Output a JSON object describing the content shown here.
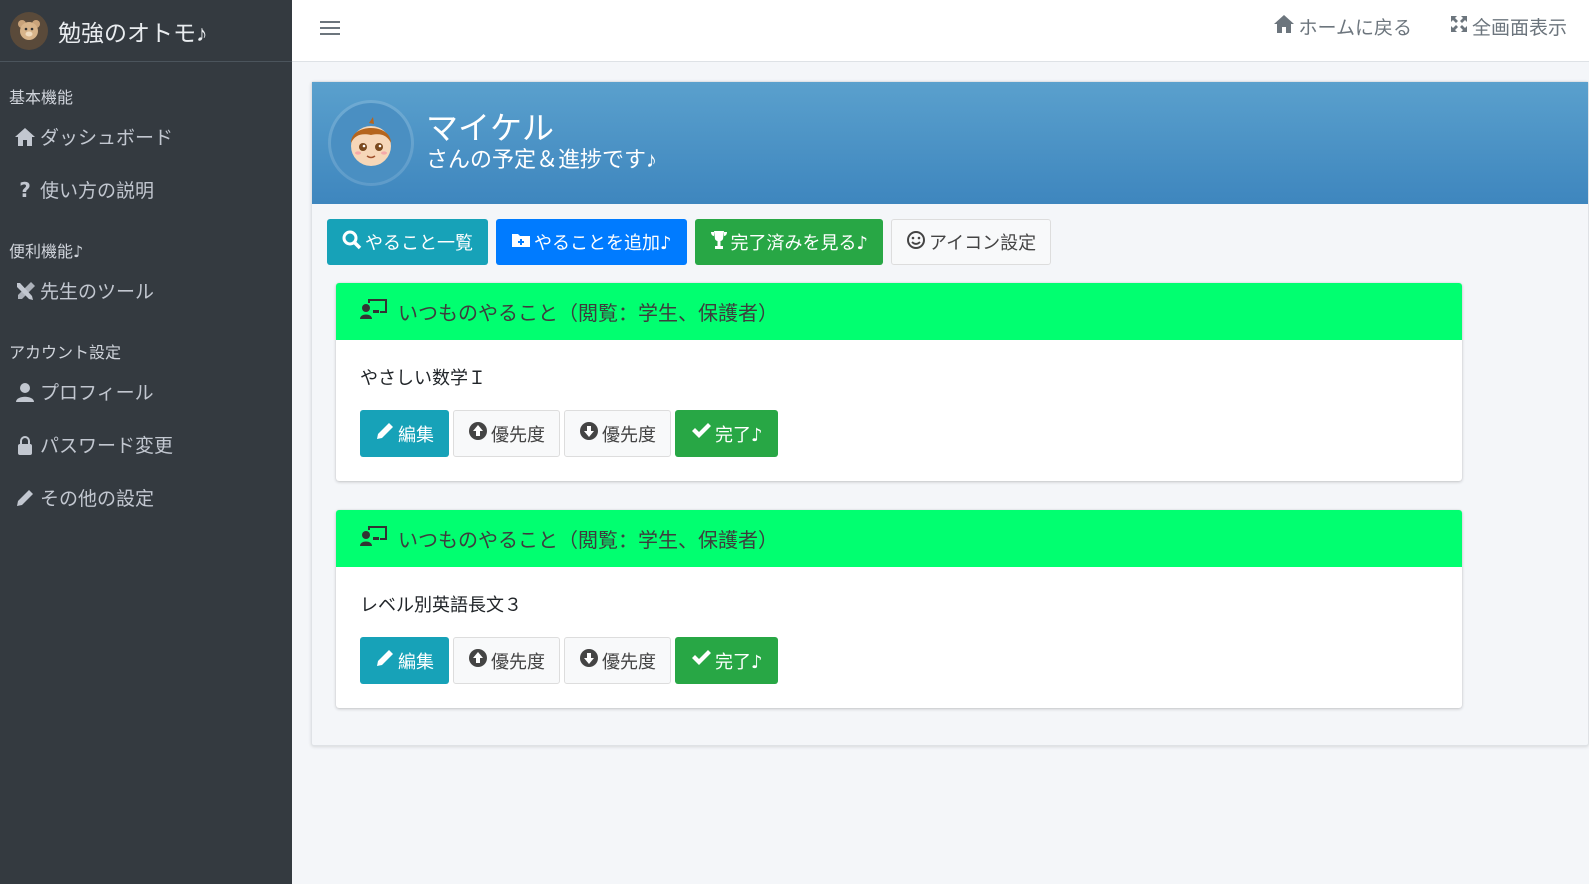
{
  "app": {
    "title": "勉強のオトモ♪"
  },
  "sidebar": {
    "sections": [
      {
        "header": "基本機能",
        "items": [
          {
            "label": "ダッシュボード",
            "icon": "home-icon"
          },
          {
            "label": "使い方の説明",
            "icon": "question-icon"
          }
        ]
      },
      {
        "header": "便利機能♪",
        "items": [
          {
            "label": "先生のツール",
            "icon": "tools-icon"
          }
        ]
      },
      {
        "header": "アカウント設定",
        "items": [
          {
            "label": "プロフィール",
            "icon": "user-icon"
          },
          {
            "label": "パスワード変更",
            "icon": "lock-icon"
          },
          {
            "label": "その他の設定",
            "icon": "pencil-icon"
          }
        ]
      }
    ]
  },
  "navbar": {
    "home_label": "ホームに戻る",
    "fullscreen_label": "全画面表示"
  },
  "profile": {
    "name": "マイケル",
    "subtitle": "さんの予定＆進捗です♪"
  },
  "actions": {
    "list_label": "やること一覧",
    "add_label": "やることを追加♪",
    "done_label": "完了済みを見る♪",
    "icon_label": "アイコン設定"
  },
  "tasks": [
    {
      "header": "いつものやること（閲覧：学生、保護者）",
      "title": "やさしい数学Ｉ",
      "edit": "編集",
      "up": "優先度",
      "down": "優先度",
      "complete": "完了♪"
    },
    {
      "header": "いつものやること（閲覧：学生、保護者）",
      "title": "レベル別英語長文３",
      "edit": "編集",
      "up": "優先度",
      "down": "優先度",
      "complete": "完了♪"
    }
  ],
  "colors": {
    "sidebar": "#343a40",
    "header_blue": "#4a90c4",
    "task_header": "#01ff70",
    "info": "#17a2b8",
    "primary": "#007bff",
    "success": "#28a745"
  }
}
